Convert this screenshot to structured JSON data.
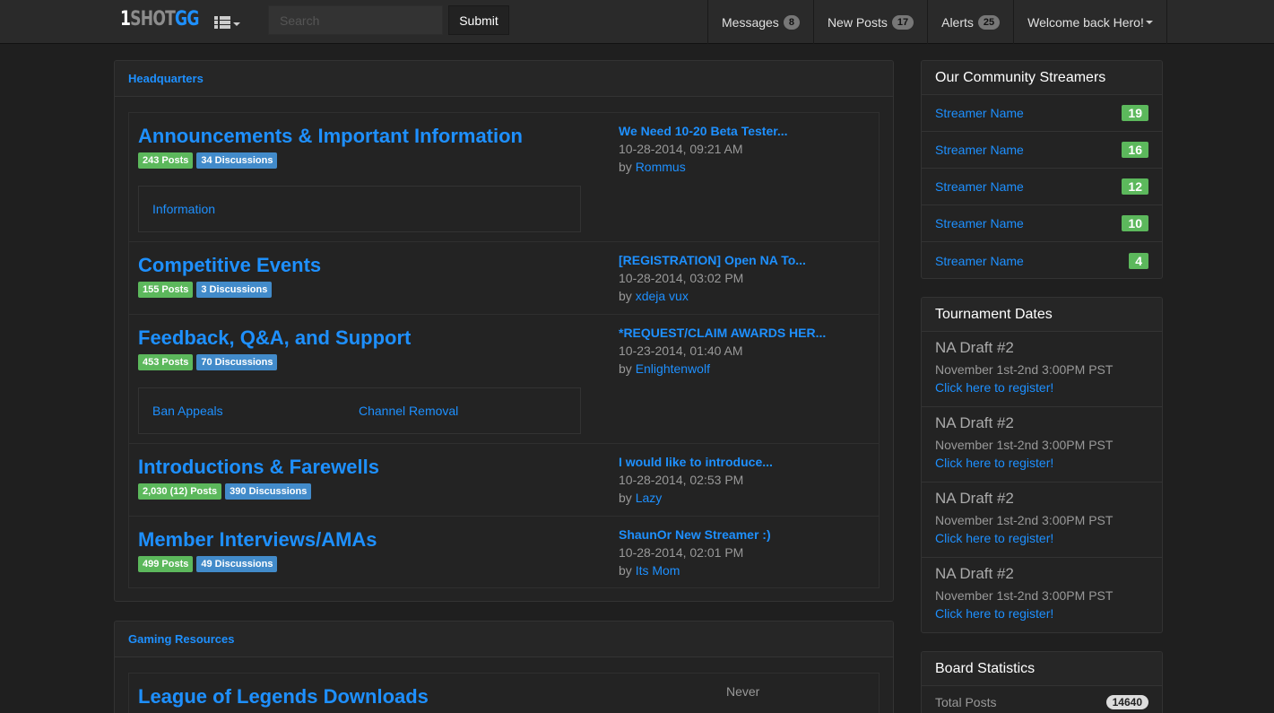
{
  "brand": {
    "part1": "1",
    "part2": "SHOT",
    "part3": "GG"
  },
  "search": {
    "placeholder": "Search",
    "submit_label": "Submit"
  },
  "nav": [
    {
      "label": "Messages",
      "count": "8"
    },
    {
      "label": "New Posts",
      "count": "17"
    },
    {
      "label": "Alerts",
      "count": "25"
    }
  ],
  "welcome": "Welcome back Hero!",
  "headquarters": {
    "title": "Headquarters",
    "forums": [
      {
        "title": "Announcements & Important Information",
        "posts": "243 Posts",
        "discussions": "34 Discussions",
        "subforums": [
          "Information"
        ],
        "last_title": "We Need 10-20 Beta Tester...",
        "last_date": "10-28-2014, 09:21 AM",
        "by": "by",
        "last_user": "Rommus"
      },
      {
        "title": "Competitive Events",
        "posts": "155 Posts",
        "discussions": "3 Discussions",
        "subforums": [],
        "last_title": "[REGISTRATION] Open NA To...",
        "last_date": "10-28-2014, 03:02 PM",
        "by": "by",
        "last_user": "xdeja vux"
      },
      {
        "title": "Feedback, Q&A, and Support",
        "posts": "453 Posts",
        "discussions": "70 Discussions",
        "subforums": [
          "Ban Appeals",
          "Channel Removal"
        ],
        "last_title": "*REQUEST/CLAIM AWARDS HER...",
        "last_date": "10-23-2014, 01:40 AM",
        "by": "by",
        "last_user": "Enlightenwolf"
      },
      {
        "title": "Introductions & Farewells",
        "posts": "2,030 (12) Posts",
        "discussions": "390 Discussions",
        "subforums": [],
        "last_title": "I would like to introduce...",
        "last_date": "10-28-2014, 02:53 PM",
        "by": "by",
        "last_user": "Lazy"
      },
      {
        "title": "Member Interviews/AMAs",
        "posts": "499 Posts",
        "discussions": "49 Discussions",
        "subforums": [],
        "last_title": "ShaunOr New Streamer :)",
        "last_date": "10-28-2014, 02:01 PM",
        "by": "by",
        "last_user": "Its Mom"
      }
    ]
  },
  "gaming": {
    "title": "Gaming Resources",
    "forum_title": "League of Legends Downloads",
    "last": "Never"
  },
  "streamers": {
    "title": "Our Community Streamers",
    "items": [
      {
        "name": "Streamer Name",
        "count": "19"
      },
      {
        "name": "Streamer Name",
        "count": "16"
      },
      {
        "name": "Streamer Name",
        "count": "12"
      },
      {
        "name": "Streamer Name",
        "count": "10"
      },
      {
        "name": "Streamer Name",
        "count": "4"
      }
    ]
  },
  "tournaments": {
    "title": "Tournament Dates",
    "items": [
      {
        "name": "NA Draft #2",
        "date": "November 1st-2nd 3:00PM PST",
        "link": "Click here to register!"
      },
      {
        "name": "NA Draft #2",
        "date": "November 1st-2nd 3:00PM PST",
        "link": "Click here to register!"
      },
      {
        "name": "NA Draft #2",
        "date": "November 1st-2nd 3:00PM PST",
        "link": "Click here to register!"
      },
      {
        "name": "NA Draft #2",
        "date": "November 1st-2nd 3:00PM PST",
        "link": "Click here to register!"
      }
    ]
  },
  "stats": {
    "title": "Board Statistics",
    "label": "Total Posts",
    "value": "14640"
  },
  "colors": {
    "accent": "#1e90ff",
    "green": "#5cb85c",
    "blue": "#428bca",
    "background": "#1f1f1f"
  },
  "icons": {
    "menu": "list-icon",
    "dropdown": "caret-down-icon"
  }
}
